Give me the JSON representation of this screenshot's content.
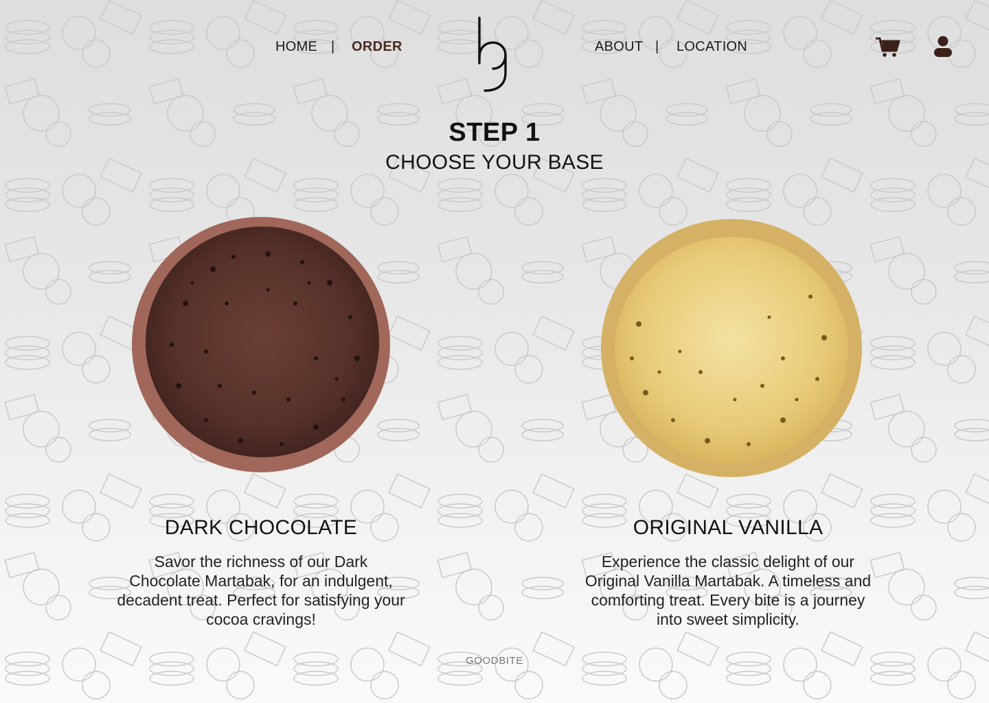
{
  "nav": {
    "left_links": [
      "HOME",
      "ORDER"
    ],
    "right_links": [
      "ABOUT",
      "LOCATION"
    ],
    "separator": "|",
    "active": "ORDER"
  },
  "icons": {
    "logo": "goodbite-logo",
    "cart": "cart-icon",
    "user": "user-icon"
  },
  "step": {
    "title": "STEP 1",
    "subtitle": "CHOOSE YOUR BASE"
  },
  "options": [
    {
      "name": "DARK CHOCOLATE",
      "description": "Savor the richness of our Dark Chocolate Martabak, for an indulgent, decadent treat. Perfect for satisfying your cocoa cravings!"
    },
    {
      "name": "ORIGINAL VANILLA",
      "description": "Experience the classic delight of our Original Vanilla Martabak. A timeless and comforting treat. Every bite is a journey into sweet simplicity."
    }
  ],
  "footer": {
    "brand": "GOODBITE"
  },
  "colors": {
    "accent": "#4a2a1f",
    "chocolate": "#5a3326",
    "vanilla": "#e7c873"
  }
}
